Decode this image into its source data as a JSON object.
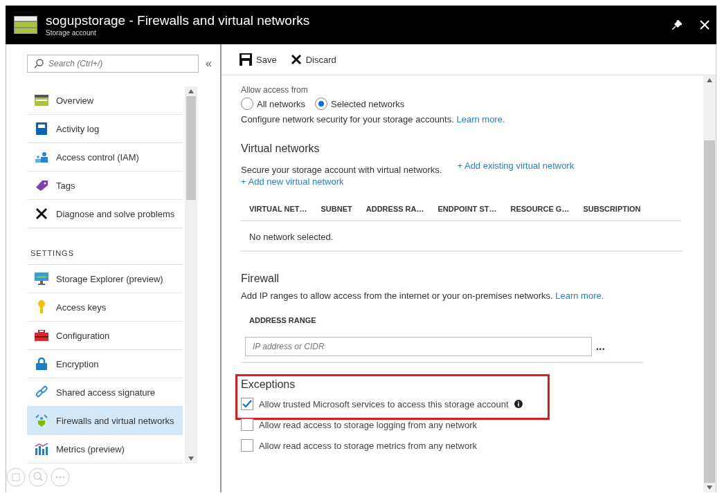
{
  "window": {
    "title": "sogupstorage - Firewalls and virtual networks",
    "subtitle": "Storage account"
  },
  "sidebar": {
    "search": {
      "placeholder": "Search (Ctrl+/)"
    },
    "collapse": "«",
    "groups": [
      {
        "items": [
          {
            "label": "Overview",
            "selected": false
          },
          {
            "label": "Activity log",
            "selected": false
          },
          {
            "label": "Access control (IAM)",
            "selected": false
          },
          {
            "label": "Tags",
            "selected": false
          },
          {
            "label": "Diagnose and solve problems",
            "selected": false
          }
        ]
      },
      {
        "heading": "SETTINGS",
        "items": [
          {
            "label": "Storage Explorer (preview)",
            "selected": false
          },
          {
            "label": "Access keys",
            "selected": false
          },
          {
            "label": "Configuration",
            "selected": false
          },
          {
            "label": "Encryption",
            "selected": false
          },
          {
            "label": "Shared access signature",
            "selected": false
          },
          {
            "label": "Firewalls and virtual networks",
            "selected": true
          },
          {
            "label": "Metrics (preview)",
            "selected": false
          }
        ]
      }
    ]
  },
  "toolbar": [
    {
      "label": "Save"
    },
    {
      "label": "Discard"
    }
  ],
  "access": {
    "label": "Allow access from",
    "options": [
      {
        "label": "All networks",
        "selected": false
      },
      {
        "label": "Selected networks",
        "selected": true
      }
    ],
    "note": "Configure network security for your storage accounts.",
    "link": "Learn more."
  },
  "virtual_networks": {
    "title": "Virtual networks",
    "description": "Secure your storage account with virtual networks.",
    "links": [
      "+ Add existing virtual network",
      "+ Add new virtual network"
    ],
    "columns": [
      "VIRTUAL NET…",
      "SUBNET",
      "ADDRESS RA…",
      "ENDPOINT ST…",
      "RESOURCE G…",
      "SUBSCRIPTION"
    ],
    "empty": "No network selected."
  },
  "firewall": {
    "title": "Firewall",
    "description": "Add IP ranges to allow access from the internet or your on-premises networks.",
    "link": "Learn more.",
    "column": "ADDRESS RANGE",
    "placeholder": "IP address or CIDR",
    "more": "..."
  },
  "exceptions": {
    "title": "Exceptions",
    "highlighted": true,
    "items": [
      {
        "label": "Allow trusted Microsoft services to access this storage account",
        "checked": true,
        "info": true
      },
      {
        "label": "Allow read access to storage logging from any network",
        "checked": false,
        "info": false
      },
      {
        "label": "Allow read access to storage metrics from any network",
        "checked": false,
        "info": false
      }
    ]
  }
}
